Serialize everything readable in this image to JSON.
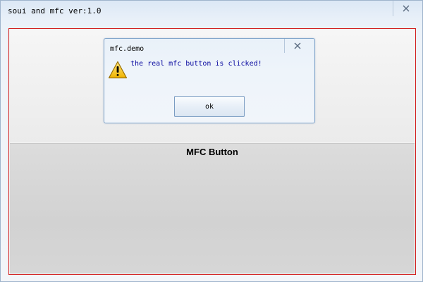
{
  "window": {
    "title": "soui and mfc ver:1.0",
    "close_icon": "close-icon"
  },
  "panel": {
    "button_label": "MFC Button",
    "border_color": "#d21f1f"
  },
  "dialog": {
    "title": "mfc.demo",
    "message": "the real mfc button is clicked!",
    "ok_label": "ok",
    "icon": "warning-icon",
    "message_color": "#0a0aa0"
  }
}
